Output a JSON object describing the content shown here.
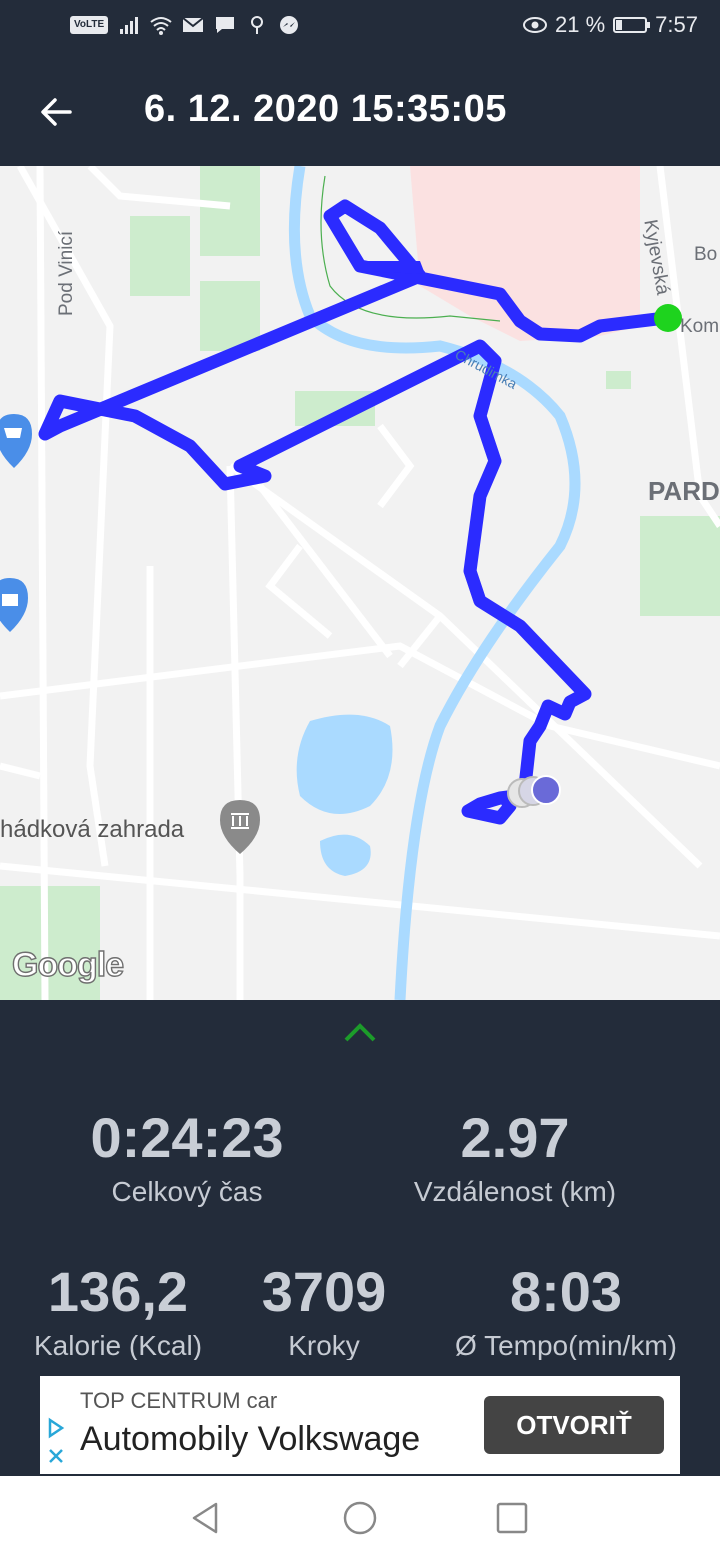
{
  "status_bar": {
    "volte": "VoLTE",
    "battery_percent": "21 %",
    "battery_level": 0.21,
    "time": "7:57",
    "icons": [
      "signal-icon",
      "wifi-icon",
      "mail-icon",
      "message-icon",
      "location-icon",
      "messenger-icon",
      "eye-icon",
      "battery-icon"
    ]
  },
  "header": {
    "title": "6. 12. 2020 15:35:05",
    "back_icon": "arrow-left-icon"
  },
  "map": {
    "labels": {
      "street_pod_vinici": "Pod Vinicí",
      "street_kyjevska": "Kyjevská",
      "river_chrudimka": "Chrudimka",
      "place_pard": "PARD",
      "place_bo": "Bo",
      "place_kom": "Kom",
      "place_zahrada": "hádková zahrada"
    },
    "attribution": "Google",
    "colors": {
      "route": "#2b2bff",
      "start": "#1ed31e",
      "end": "#6a6ad8",
      "water": "#aadaff",
      "park": "#cdeccd",
      "urban": "#fbe1e1"
    }
  },
  "expand_icon": "chevron-up-icon",
  "stats": {
    "total_time": {
      "value": "0:24:23",
      "label": "Celkový čas"
    },
    "distance": {
      "value": "2.97",
      "label": "Vzdálenost (km)"
    },
    "calories": {
      "value": "136,2",
      "label": "Kalorie (Kcal)"
    },
    "steps": {
      "value": "3709",
      "label": "Kroky"
    },
    "pace": {
      "value": "8:03",
      "label": "Ø Tempo(min/km)"
    }
  },
  "ad": {
    "subtitle": "TOP CENTRUM car",
    "headline": "Automobily Volkswage",
    "button": "OTVORIŤ"
  },
  "nav": {
    "back": "nav-back-icon",
    "home": "nav-home-icon",
    "recents": "nav-recents-icon"
  }
}
